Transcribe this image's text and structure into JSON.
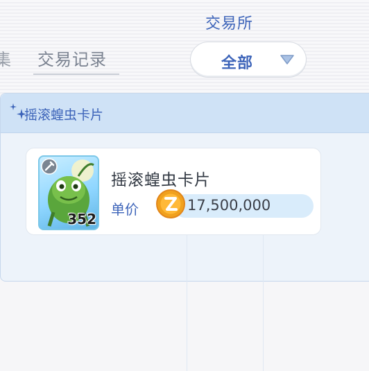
{
  "header": {
    "title": "交易所",
    "tabs": [
      {
        "label": "集",
        "active": false
      },
      {
        "label": "交易记录",
        "active": true
      }
    ],
    "filter": {
      "selected": "全部"
    }
  },
  "panel": {
    "title": "摇滚蝗虫卡片",
    "items": [
      {
        "name": "摇滚蝗虫卡片",
        "quantity": "352",
        "price_label": "单价",
        "price": "17,500,000",
        "currency_icon": "z-coin-icon",
        "thumbnail_icon": "grasshopper-card-icon",
        "badge_icon": "sword-icon"
      }
    ]
  },
  "colors": {
    "accent": "#3d64b9",
    "panel_header": "#cfe2f6",
    "coin": "#f5a623"
  }
}
